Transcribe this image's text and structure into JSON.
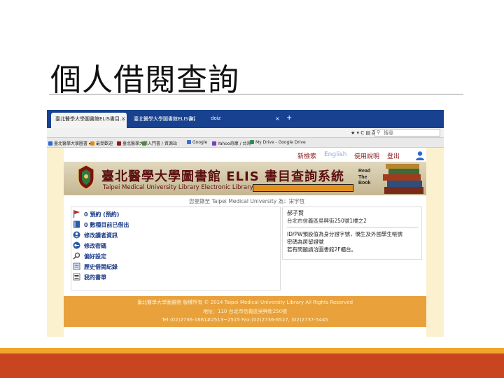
{
  "slide": {
    "title": "個人借閱查詢"
  },
  "browser": {
    "tabs": [
      {
        "label": "臺北醫學大學圖書館ELIS書目…",
        "active": true
      },
      {
        "label": "臺北醫學大學圖書館ELIS書目…",
        "active": false
      },
      {
        "label": "doiz",
        "active": false
      }
    ],
    "close_glyph": "×",
    "new_tab_glyph": "+",
    "address_right_text": "★ ▾ C  ▤ 英巽",
    "search_placeholder": "搜尋",
    "bookmarks": [
      {
        "label": "臺北醫學大學圖書 ▾",
        "color": "#2a6bd1"
      },
      {
        "label": "最受歡迎",
        "color": "#e08a1e"
      },
      {
        "label": "臺北醫學大學",
        "color": "#8a1b1b"
      },
      {
        "label": "入門書 / 資源站",
        "color": "#4a8a3a"
      },
      {
        "label": "Google",
        "color": "#3b6fd8"
      },
      {
        "label": "Yahoo奇摩 / 台灣",
        "color": "#7b3fb3"
      },
      {
        "label": "My Drive - Google Drive",
        "color": "#2e8b57"
      }
    ]
  },
  "site": {
    "top_links": [
      "新檢索",
      "English",
      "使用說明",
      "登出"
    ],
    "banner_title": "臺北醫學大學圖書館 ELIS 書目查詢系統",
    "banner_subtitle": "Taipei Medical University Library Electronic Library",
    "read_the_book": "Read The Book",
    "welcome": "您登錄至 Taipei Medical University 為：宋宇恆",
    "menu": [
      {
        "label": "0 預約 (預約)",
        "icon": "flag-icon",
        "color": "#c0202a"
      },
      {
        "label": "0 數種目前已借出",
        "icon": "book-icon",
        "color": "#2a5aa8"
      },
      {
        "label": "修改讀者資訊",
        "icon": "user-edit-icon",
        "color": "#2a5aa8"
      },
      {
        "label": "修改密碼",
        "icon": "key-icon",
        "color": "#2a5aa8"
      },
      {
        "label": "偏好設定",
        "icon": "search-icon",
        "color": "#2a5aa8"
      },
      {
        "label": "歷史借閱紀錄",
        "icon": "history-icon",
        "color": "#2a5aa8"
      },
      {
        "label": "我的書單",
        "icon": "list-icon",
        "color": "#2a5aa8"
      }
    ],
    "info": {
      "name": "郝子賢",
      "address": "台北市信義區吳興街250號1樓之2",
      "lines": [
        "ID/PW預設值為身分證字號，僑生及外國學生帳號",
        "密碼為居留證號",
        "若有問題請洽圖書館2F櫃台。"
      ]
    },
    "footer": [
      "臺北醫學大學圖書館 版權所有 © 2014 Taipei Medical University Library All Rights Reserved",
      "地址：110 台北市信義區吳興街250號",
      "Tel:(02)2736-1661#2513~2515  Fax:(02)2736-6527, (02)2737-5445"
    ]
  },
  "colors": {
    "tab_bar": "#18428f",
    "footer": "#e8a13b",
    "accent_orange": "#f2a52c",
    "accent_red": "#c9451f",
    "link_red": "#8a1b1b"
  }
}
